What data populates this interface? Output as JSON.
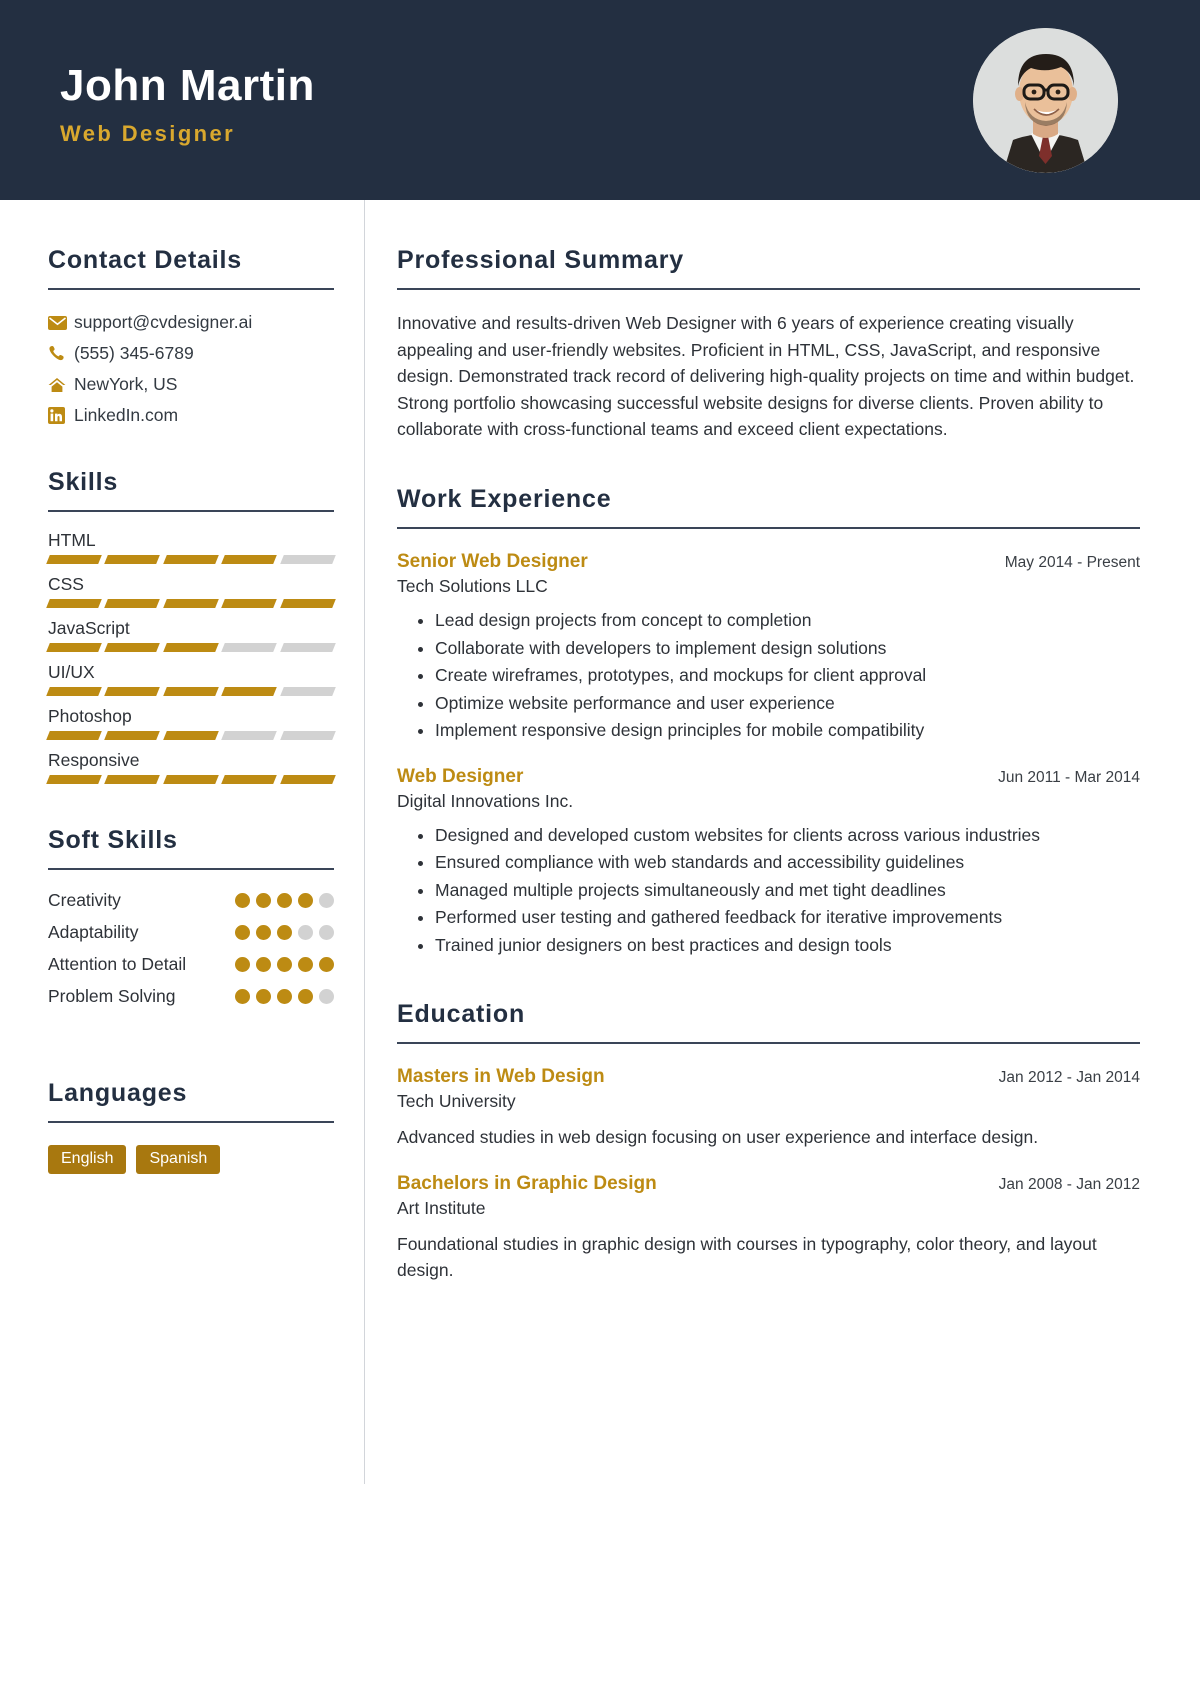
{
  "header": {
    "name": "John Martin",
    "job_title": "Web Designer",
    "photo_alt": "profile-photo"
  },
  "colors": {
    "header_bg": "#232f41",
    "accent_gold": "#bd8b13",
    "title_gold": "#d9a82e",
    "text_dark": "#2e3238",
    "rule": "#3a4558",
    "segment_off": "#d2d2d2"
  },
  "sidebar": {
    "contact": {
      "title": "Contact Details",
      "items": [
        {
          "icon": "envelope-icon",
          "text": "support@cvdesigner.ai"
        },
        {
          "icon": "phone-icon",
          "text": "(555) 345-6789"
        },
        {
          "icon": "home-icon",
          "text": "NewYork, US"
        },
        {
          "icon": "linkedin-icon",
          "text": "LinkedIn.com"
        }
      ]
    },
    "skills": {
      "title": "Skills",
      "max": 5,
      "items": [
        {
          "name": "HTML",
          "level": 4
        },
        {
          "name": "CSS",
          "level": 5
        },
        {
          "name": "JavaScript",
          "level": 3
        },
        {
          "name": "UI/UX",
          "level": 4
        },
        {
          "name": "Photoshop",
          "level": 3
        },
        {
          "name": "Responsive",
          "level": 5
        }
      ]
    },
    "soft_skills": {
      "title": "Soft Skills",
      "max": 5,
      "items": [
        {
          "name": "Creativity",
          "level": 4
        },
        {
          "name": "Adaptability",
          "level": 3
        },
        {
          "name": "Attention to Detail",
          "level": 5
        },
        {
          "name": "Problem Solving",
          "level": 4
        }
      ]
    },
    "languages": {
      "title": "Languages",
      "items": [
        "English",
        "Spanish"
      ]
    }
  },
  "main": {
    "summary": {
      "title": "Professional Summary",
      "text": "Innovative and results-driven Web Designer with 6 years of experience creating visually appealing and user-friendly websites. Proficient in HTML, CSS, JavaScript, and responsive design. Demonstrated track record of delivering high-quality projects on time and within budget. Strong portfolio showcasing successful website designs for diverse clients. Proven ability to collaborate with cross-functional teams and exceed client expectations."
    },
    "work": {
      "title": "Work Experience",
      "entries": [
        {
          "role": "Senior Web Designer",
          "date": "May 2014 - Present",
          "org": "Tech Solutions LLC",
          "bullets": [
            "Lead design projects from concept to completion",
            "Collaborate with developers to implement design solutions",
            "Create wireframes, prototypes, and mockups for client approval",
            "Optimize website performance and user experience",
            "Implement responsive design principles for mobile compatibility"
          ]
        },
        {
          "role": "Web Designer",
          "date": "Jun 2011 - Mar 2014",
          "org": "Digital Innovations Inc.",
          "bullets": [
            "Designed and developed custom websites for clients across various industries",
            "Ensured compliance with web standards and accessibility guidelines",
            "Managed multiple projects simultaneously and met tight deadlines",
            "Performed user testing and gathered feedback for iterative improvements",
            "Trained junior designers on best practices and design tools"
          ]
        }
      ]
    },
    "education": {
      "title": "Education",
      "entries": [
        {
          "degree": "Masters in Web Design",
          "date": "Jan 2012 - Jan 2014",
          "school": "Tech University",
          "description": "Advanced studies in web design focusing on user experience and interface design."
        },
        {
          "degree": "Bachelors in Graphic Design",
          "date": "Jan 2008 - Jan 2012",
          "school": "Art Institute",
          "description": "Foundational studies in graphic design with courses in typography, color theory, and layout design."
        }
      ]
    }
  }
}
